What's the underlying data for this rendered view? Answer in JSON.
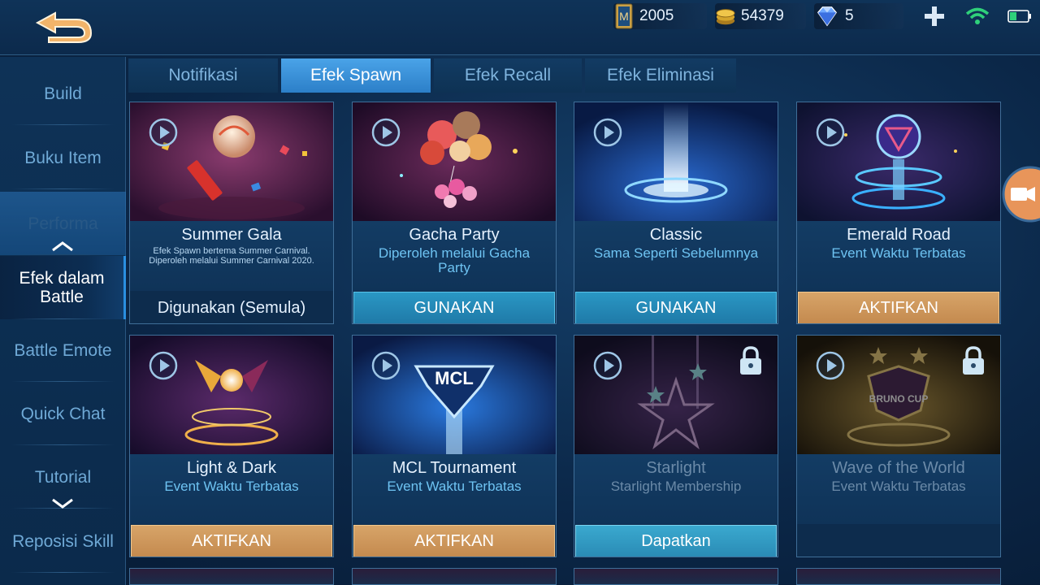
{
  "topbar": {
    "ticket_count": "2005",
    "gold_count": "54379",
    "diamond_count": "5"
  },
  "sidebar": {
    "items": [
      {
        "label": "Build"
      },
      {
        "label": "Buku Item"
      },
      {
        "label": "Performa"
      },
      {
        "label": "Efek dalam Battle"
      },
      {
        "label": "Battle Emote"
      },
      {
        "label": "Quick Chat"
      },
      {
        "label": "Tutorial"
      },
      {
        "label": "Reposisi Skill"
      }
    ]
  },
  "tabs": [
    {
      "label": "Notifikasi"
    },
    {
      "label": "Efek Spawn"
    },
    {
      "label": "Efek Recall"
    },
    {
      "label": "Efek Eliminasi"
    }
  ],
  "cards": [
    {
      "title": "Summer Gala",
      "subtitle": "Efek Spawn bertema Summer Carnival. Diperoleh melalui Summer Carnival 2020.",
      "button": "Digunakan (Semula)"
    },
    {
      "title": "Gacha Party",
      "subtitle": "Diperoleh melalui Gacha Party",
      "button": "GUNAKAN"
    },
    {
      "title": "Classic",
      "subtitle": "Sama Seperti Sebelumnya",
      "button": "GUNAKAN"
    },
    {
      "title": "Emerald Road",
      "subtitle": "Event Waktu Terbatas",
      "button": "AKTIFKAN"
    },
    {
      "title": "Light & Dark",
      "subtitle": "Event Waktu Terbatas",
      "button": "AKTIFKAN"
    },
    {
      "title": "MCL Tournament",
      "subtitle": "Event Waktu Terbatas",
      "button": "AKTIFKAN"
    },
    {
      "title": "Starlight",
      "subtitle": "Starlight Membership",
      "button": "Dapatkan"
    },
    {
      "title": "Wave of the World",
      "subtitle": "Event Waktu Terbatas",
      "button": ""
    }
  ],
  "art_labels": {
    "mcl": "MCL",
    "bruno": "BRUNO CUP"
  },
  "colors": {
    "button_blue": "#1f7aa8",
    "button_orange": "#c48a4f",
    "tab_active": "#2c7fc8",
    "accent_text": "#6ec3f2"
  }
}
